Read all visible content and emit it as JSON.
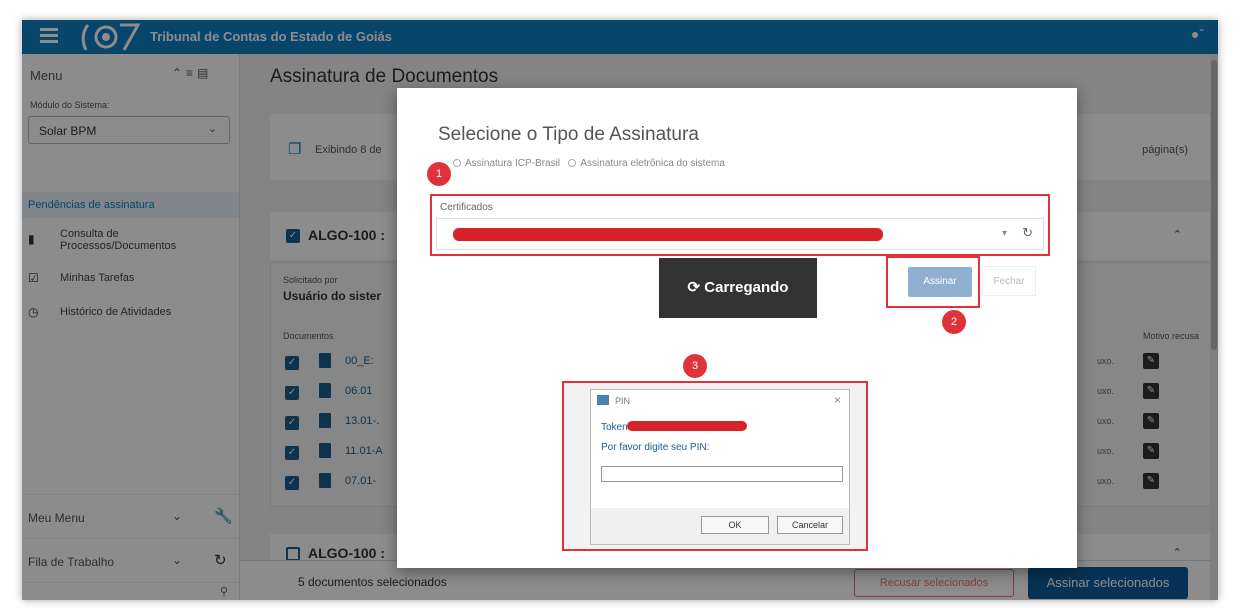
{
  "header": {
    "title": "Tribunal de Contas do Estado de Goiás",
    "user_icon": "user-circle-icon"
  },
  "sidebar": {
    "menu_title": "Menu",
    "modulo_label": "Módulo do Sistema:",
    "modulo_value": "Solar BPM",
    "items": [
      {
        "label": "Pendências de assinatura",
        "icon": "none"
      },
      {
        "label": "Consulta de Processos/Documentos",
        "icon": "file-icon"
      },
      {
        "label": "Minhas Tarefas",
        "icon": "calendar-check-icon"
      },
      {
        "label": "Histórico de Atividades",
        "icon": "clock-icon"
      }
    ],
    "meu_menu": "Meu Menu",
    "fila_trabalho": "Fila de Trabalho"
  },
  "main": {
    "page_title": "Assinatura de Documentos",
    "exibindo": "Exibindo 8 de",
    "paginas": "página(s)",
    "group1_title": "ALGO-100 :",
    "solicitado_label": "Solicitado por",
    "solicitado_value": "Usuário do sister",
    "documentos_label": "Documentos",
    "motivo_label": "Motivo recusa",
    "documents": [
      {
        "name": "00_E:",
        "right": "uxo."
      },
      {
        "name": "06.01",
        "right": "uxo."
      },
      {
        "name": "13.01-.",
        "right": "uxo."
      },
      {
        "name": "11.01-A",
        "right": "uxo."
      },
      {
        "name": "07.01-",
        "right": "uxo."
      }
    ],
    "group2_title": "ALGO-100 :",
    "footer_count": "5 documentos selecionados",
    "recusar_label": "Recusar selecionados",
    "assinar_sel_label": "Assinar selecionados"
  },
  "modal": {
    "title": "Selecione o Tipo de Assinatura",
    "radio1": "Assinatura ICP-Brasil",
    "radio2": "Assinatura eletrônica do sistema",
    "cert_label": "Certificados",
    "loading": "Carregando",
    "assinar": "Assinar",
    "fechar": "Fechar",
    "badges": [
      "1",
      "2",
      "3"
    ]
  },
  "pin_dialog": {
    "title": "PIN",
    "token_label": "Token",
    "prompt": "Por favor digite seu PIN:",
    "ok": "OK",
    "cancel": "Cancelar"
  },
  "colors": {
    "brand": "#0d7fc2",
    "annotation": "#e0323b",
    "primary_button": "#0d5c9c"
  }
}
